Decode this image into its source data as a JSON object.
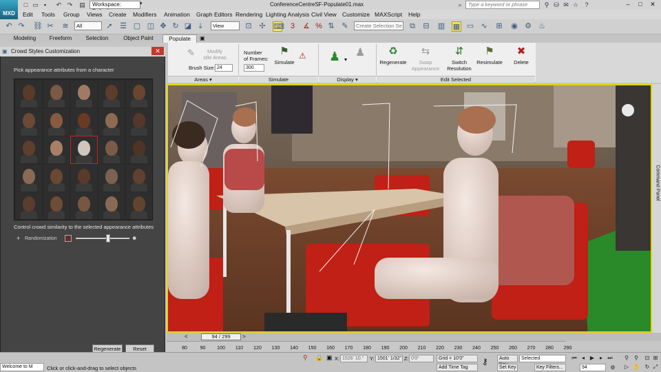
{
  "app": {
    "logo_text": "MXD",
    "workspace": "Workspace: Default",
    "document_title": "ConferenceCentreSF-Populate01.max",
    "search_placeholder": "Type a keyword or phrase"
  },
  "menu": [
    "Edit",
    "Tools",
    "Group",
    "Views",
    "Create",
    "Modifiers",
    "Animation",
    "Graph Editors",
    "Rendering",
    "Lighting Analysis",
    "Civil View",
    "Customize",
    "MAXScript",
    "Help"
  ],
  "toolbar": {
    "selection_filter": "All",
    "reference_coord": "View",
    "named_selection_placeholder": "Create Selection Se",
    "angle_snap": "3"
  },
  "ribbon_tabs": [
    "Modeling",
    "Freeform",
    "Selection",
    "Object Paint",
    "Populate"
  ],
  "active_ribbon_tab": "Populate",
  "ribbon": {
    "areas": {
      "modify_idle_label": "Modify\nIdle Areas",
      "brush_size_label": "Brush Size:",
      "brush_size_value": "24",
      "group_label": "Areas"
    },
    "simulate": {
      "frames_label": "Number\nof Frames:",
      "frames_value": "300",
      "simulate_label": "Simulate",
      "group_label": "Simulate"
    },
    "display": {
      "group_label": "Display"
    },
    "edit_selected": {
      "regenerate": "Regenerate",
      "swap_appearance": "Swap\nAppearance",
      "switch_resolution": "Switch\nResolution",
      "resimulate": "Resimulate",
      "delete": "Delete",
      "group_label": "Edit Selected"
    }
  },
  "dialog": {
    "title": "Crowd Styles Customization",
    "pick_caption": "Pick appearance attributes from a character",
    "similarity_caption": "Control crowd similarity to the selected appearance attributes",
    "randomization_label": "Randomization",
    "randomization_value": 0.6,
    "regenerate_button": "Regenerate",
    "reset_button": "Reset",
    "faces": [
      [
        "#5a3a28",
        "#7a5a44",
        "#a07a62",
        "#5c3c2a",
        "#6b4530"
      ],
      [
        "#6a4a36",
        "#8a5a40",
        "#6a3a24",
        "#8e6a52",
        "#54382a"
      ],
      [
        "#5e3e2c",
        "#a88068",
        "#cfc6c0",
        "#7a5a48",
        "#4e3426"
      ],
      [
        "#8a6a54",
        "#6a4832",
        "#5a3a2a",
        "#7c6050",
        "#604030"
      ],
      [
        "#5c3c2c",
        "#6e4c38",
        "#7a5642",
        "#8a6a56",
        "#62442e"
      ]
    ],
    "selected_face": [
      2,
      2
    ]
  },
  "command_panel_label": "Command Panel",
  "timeline": {
    "current": "94 / 299",
    "ticks": [
      "80",
      "90",
      "100",
      "110",
      "120",
      "130",
      "140",
      "150",
      "160",
      "170",
      "180",
      "190",
      "200",
      "210",
      "220",
      "230",
      "240",
      "250",
      "260",
      "270",
      "280",
      "290"
    ]
  },
  "status": {
    "maxscript": "Welcome to M",
    "prompt": "Click or click-and-drag to select objects",
    "x_label": "X:",
    "x_value": "1526' 10.\"",
    "y_label": "Y:",
    "y_value": "1501' 1/32\"",
    "z_label": "Z:",
    "z_value": "0'0\"",
    "grid": "Grid = 10'0\"",
    "add_time_tag": "Add Time Tag",
    "auto_key": "Auto Key",
    "set_key": "Set Key",
    "key_mode": "Selected",
    "key_filters": "Key Filters...",
    "frame_value": "94"
  }
}
